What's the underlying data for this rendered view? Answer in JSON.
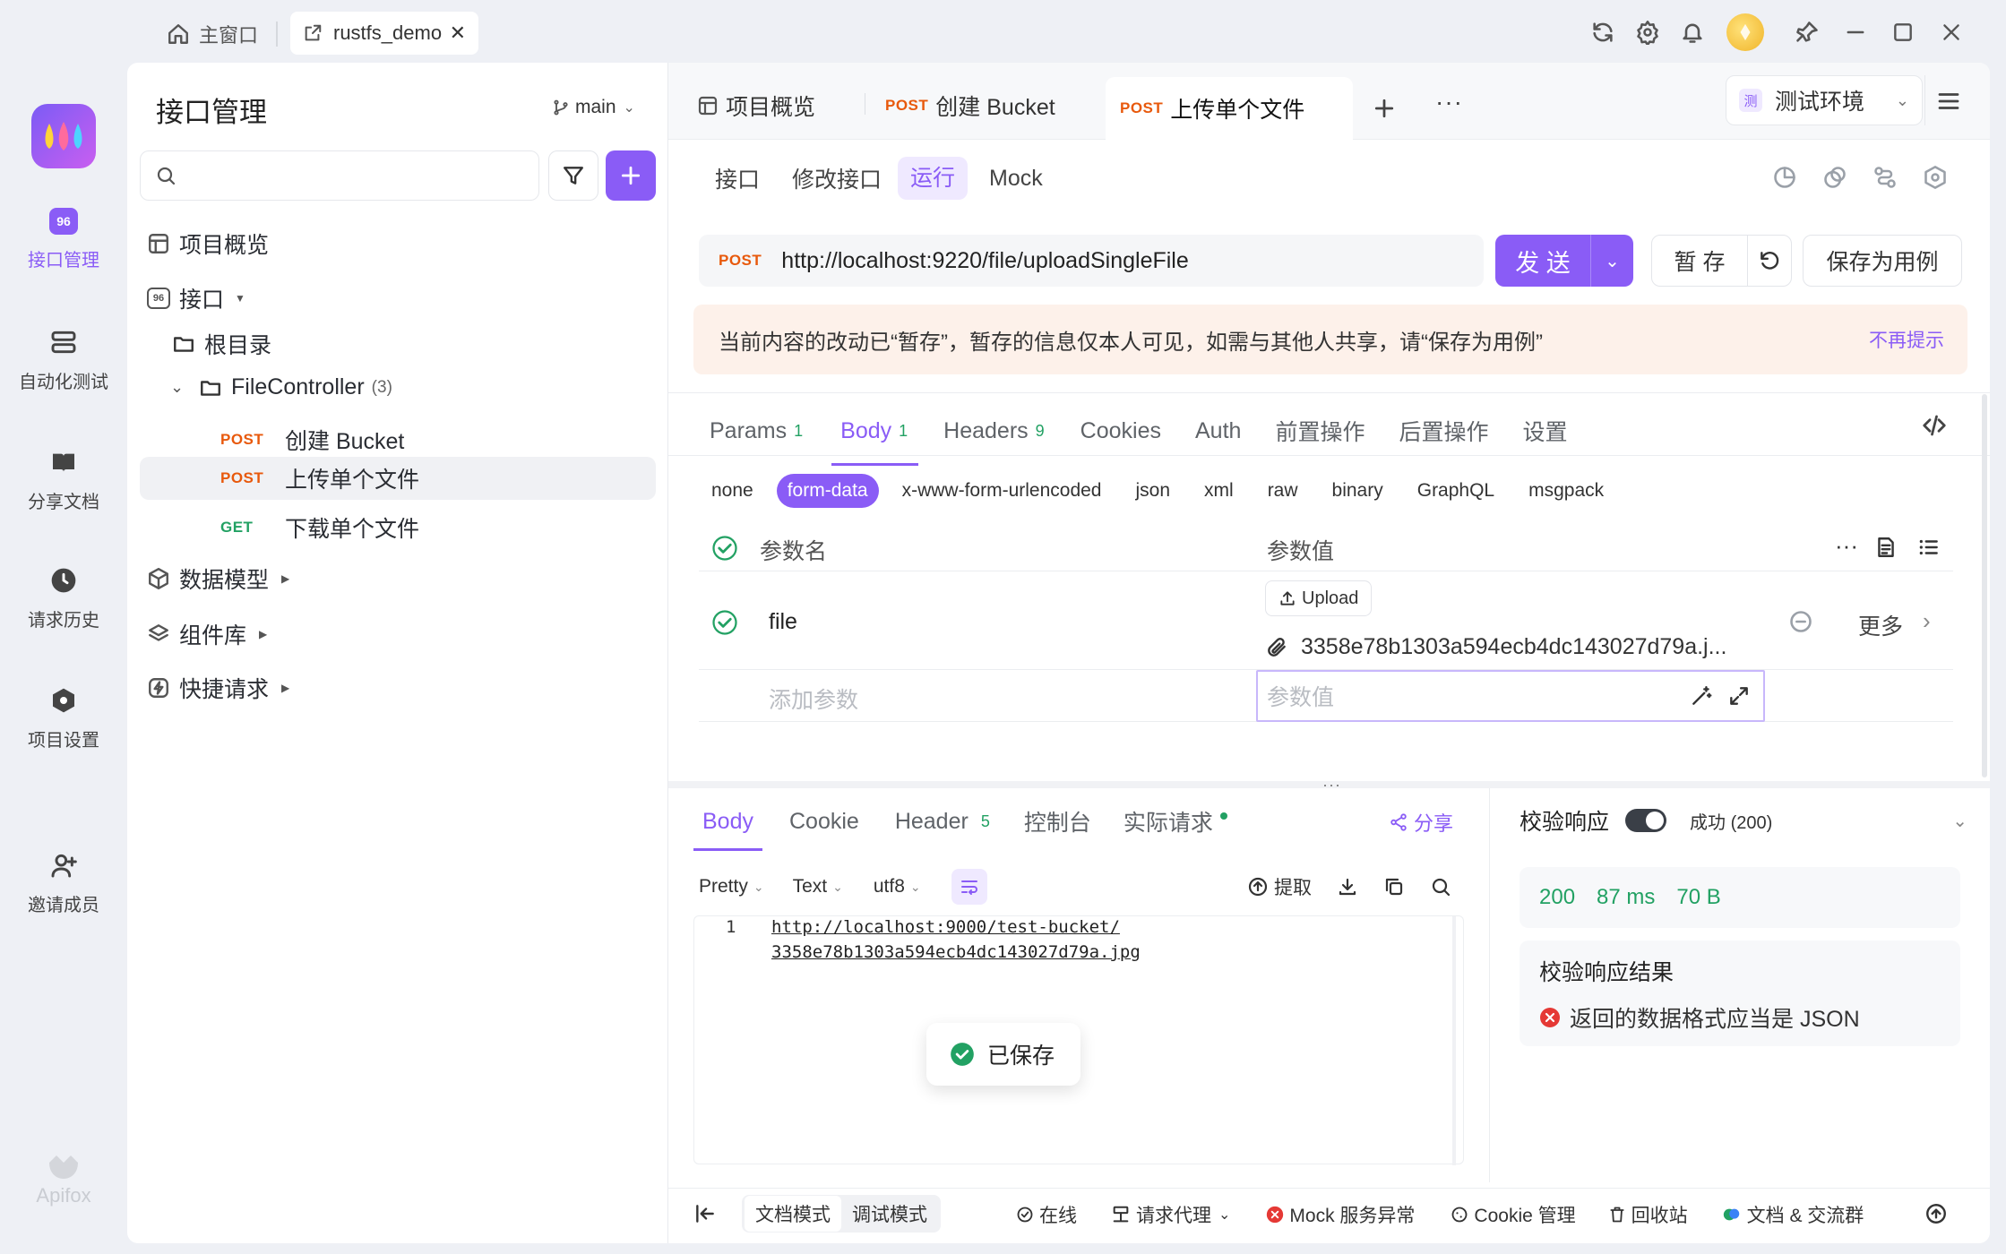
{
  "titlebar": {
    "home_label": "主窗口",
    "active_tab_label": "rustfs_demo"
  },
  "sidebar": {
    "items": [
      {
        "label": "接口管理"
      },
      {
        "label": "自动化测试"
      },
      {
        "label": "分享文档"
      },
      {
        "label": "请求历史"
      },
      {
        "label": "项目设置"
      },
      {
        "label": "邀请成员"
      }
    ],
    "brand": "Apifox"
  },
  "panel": {
    "title": "接口管理",
    "branch": "main",
    "search_placeholder": "",
    "tree": {
      "overview": "项目概览",
      "api": "接口",
      "root": "根目录",
      "folder": "FileController",
      "folder_count": "(3)",
      "endpoints": [
        {
          "method": "POST",
          "name": "创建 Bucket"
        },
        {
          "method": "POST",
          "name": "上传单个文件"
        },
        {
          "method": "GET",
          "name": "下载单个文件"
        }
      ],
      "models": "数据模型",
      "components": "组件库",
      "quick": "快捷请求"
    }
  },
  "doc_tabs": {
    "overview": "项目概览",
    "tab1_method": "POST",
    "tab1_name": "创建 Bucket",
    "tab2_method": "POST",
    "tab2_name": "上传单个文件",
    "env": "测试环境",
    "env_icon": "测"
  },
  "subtabs": [
    "接口",
    "修改接口",
    "运行",
    "Mock"
  ],
  "request": {
    "method": "POST",
    "url": "http://localhost:9220/file/uploadSingleFile",
    "send": "发 送",
    "stash": "暂 存",
    "save_case": "保存为用例"
  },
  "notice": {
    "text": "当前内容的改动已“暂存”，暂存的信息仅本人可见，如需与其他人共享，请“保存为用例”",
    "dismiss": "不再提示"
  },
  "req_tabs": [
    {
      "label": "Params",
      "count": "1"
    },
    {
      "label": "Body",
      "count": "1"
    },
    {
      "label": "Headers",
      "count": "9"
    },
    {
      "label": "Cookies",
      "count": ""
    },
    {
      "label": "Auth",
      "count": ""
    },
    {
      "label": "前置操作",
      "count": ""
    },
    {
      "label": "后置操作",
      "count": ""
    },
    {
      "label": "设置",
      "count": ""
    }
  ],
  "body_types": [
    "none",
    "form-data",
    "x-www-form-urlencoded",
    "json",
    "xml",
    "raw",
    "binary",
    "GraphQL",
    "msgpack"
  ],
  "params_table": {
    "col_name": "参数名",
    "col_value": "参数值",
    "row_name": "file",
    "upload": "Upload",
    "file_value": "3358e78b1303a594ecb4dc143027d79a.j...",
    "more": "更多",
    "add_placeholder": "添加参数",
    "value_placeholder": "参数值"
  },
  "resp_tabs": [
    {
      "label": "Body",
      "count": ""
    },
    {
      "label": "Cookie",
      "count": ""
    },
    {
      "label": "Header",
      "count": "5"
    },
    {
      "label": "控制台",
      "count": ""
    },
    {
      "label": "实际请求",
      "count": ""
    }
  ],
  "resp_share": "分享",
  "resp_toolbar": {
    "format": "Pretty",
    "type": "Text",
    "encoding": "utf8",
    "extract": "提取"
  },
  "resp_body": {
    "line_no": "1",
    "line1": "http://localhost:9000/test-bucket/",
    "line2": "3358e78b1303a594ecb4dc143027d79a.jpg"
  },
  "toast": "已保存",
  "validate": {
    "label": "校验响应",
    "status": "成功 (200)",
    "code": "200",
    "time": "87 ms",
    "size": "70 B",
    "result_title": "校验响应结果",
    "result_msg": "返回的数据格式应当是 JSON"
  },
  "statusbar": {
    "doc_mode": "文档模式",
    "debug_mode": "调试模式",
    "online": "在线",
    "proxy": "请求代理",
    "mock": "Mock 服务异常",
    "cookie": "Cookie 管理",
    "trash": "回收站",
    "community": "文档 & 交流群"
  },
  "colors": {
    "accent": "#8a5cf6",
    "post": "#e8590c",
    "get": "#22a163",
    "notice_bg": "#fdf1ea",
    "error": "#e53935"
  }
}
